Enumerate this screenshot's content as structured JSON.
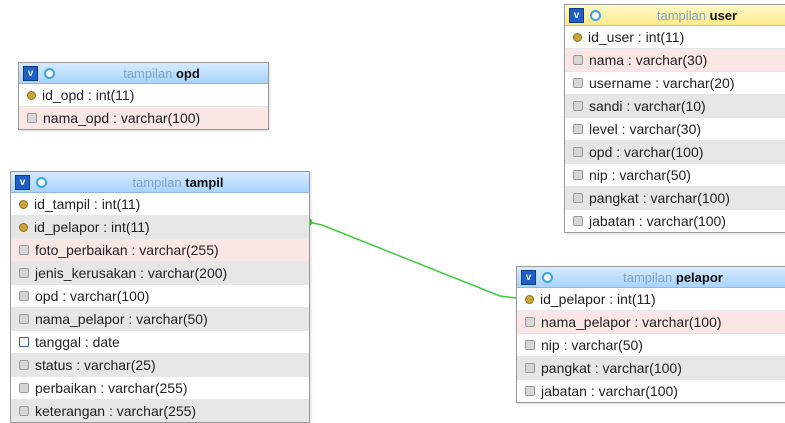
{
  "colors": {
    "relation_line": "#3ccc3c",
    "header_blue": "#b7dcff",
    "header_yellow": "#fcee9f"
  },
  "tables": {
    "opd": {
      "prefix": "tampilan",
      "name": "opd",
      "rows": [
        "id_opd : int(11)",
        "nama_opd : varchar(100)"
      ]
    },
    "user": {
      "prefix": "tampilan",
      "name": "user",
      "rows": [
        "id_user : int(11)",
        "nama : varchar(30)",
        "username : varchar(20)",
        "sandi : varchar(10)",
        "level : varchar(30)",
        "opd : varchar(100)",
        "nip : varchar(50)",
        "pangkat : varchar(100)",
        "jabatan : varchar(100)"
      ]
    },
    "tampil": {
      "prefix": "tampilan",
      "name": "tampil",
      "rows": [
        "id_tampil : int(11)",
        "id_pelapor : int(11)",
        "foto_perbaikan : varchar(255)",
        "jenis_kerusakan : varchar(200)",
        "opd : varchar(100)",
        "nama_pelapor : varchar(50)",
        "tanggal : date",
        "status : varchar(25)",
        "perbaikan : varchar(255)",
        "keterangan : varchar(255)"
      ]
    },
    "pelapor": {
      "prefix": "tampilan",
      "name": "pelapor",
      "rows": [
        "id_pelapor : int(11)",
        "nama_pelapor : varchar(100)",
        "nip : varchar(50)",
        "pangkat : varchar(100)",
        "jabatan : varchar(100)"
      ]
    }
  }
}
